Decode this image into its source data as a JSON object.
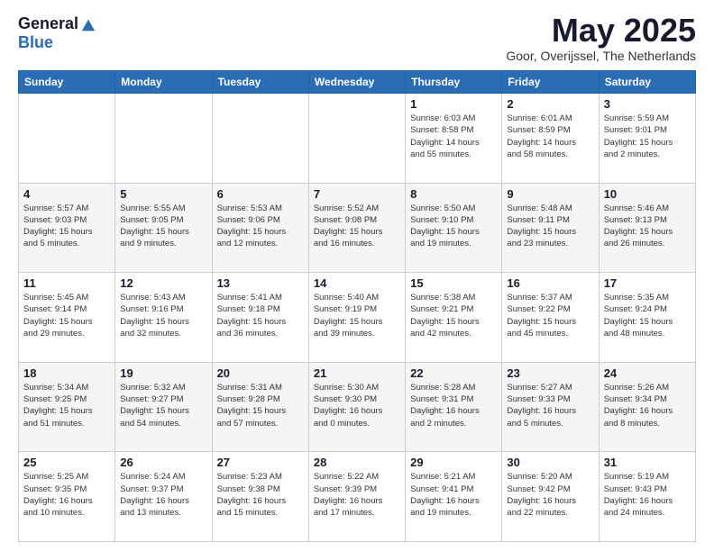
{
  "logo": {
    "general": "General",
    "blue": "Blue"
  },
  "title": "May 2025",
  "location": "Goor, Overijssel, The Netherlands",
  "headers": [
    "Sunday",
    "Monday",
    "Tuesday",
    "Wednesday",
    "Thursday",
    "Friday",
    "Saturday"
  ],
  "weeks": [
    [
      {
        "day": "",
        "info": ""
      },
      {
        "day": "",
        "info": ""
      },
      {
        "day": "",
        "info": ""
      },
      {
        "day": "",
        "info": ""
      },
      {
        "day": "1",
        "info": "Sunrise: 6:03 AM\nSunset: 8:58 PM\nDaylight: 14 hours\nand 55 minutes."
      },
      {
        "day": "2",
        "info": "Sunrise: 6:01 AM\nSunset: 8:59 PM\nDaylight: 14 hours\nand 58 minutes."
      },
      {
        "day": "3",
        "info": "Sunrise: 5:59 AM\nSunset: 9:01 PM\nDaylight: 15 hours\nand 2 minutes."
      }
    ],
    [
      {
        "day": "4",
        "info": "Sunrise: 5:57 AM\nSunset: 9:03 PM\nDaylight: 15 hours\nand 5 minutes."
      },
      {
        "day": "5",
        "info": "Sunrise: 5:55 AM\nSunset: 9:05 PM\nDaylight: 15 hours\nand 9 minutes."
      },
      {
        "day": "6",
        "info": "Sunrise: 5:53 AM\nSunset: 9:06 PM\nDaylight: 15 hours\nand 12 minutes."
      },
      {
        "day": "7",
        "info": "Sunrise: 5:52 AM\nSunset: 9:08 PM\nDaylight: 15 hours\nand 16 minutes."
      },
      {
        "day": "8",
        "info": "Sunrise: 5:50 AM\nSunset: 9:10 PM\nDaylight: 15 hours\nand 19 minutes."
      },
      {
        "day": "9",
        "info": "Sunrise: 5:48 AM\nSunset: 9:11 PM\nDaylight: 15 hours\nand 23 minutes."
      },
      {
        "day": "10",
        "info": "Sunrise: 5:46 AM\nSunset: 9:13 PM\nDaylight: 15 hours\nand 26 minutes."
      }
    ],
    [
      {
        "day": "11",
        "info": "Sunrise: 5:45 AM\nSunset: 9:14 PM\nDaylight: 15 hours\nand 29 minutes."
      },
      {
        "day": "12",
        "info": "Sunrise: 5:43 AM\nSunset: 9:16 PM\nDaylight: 15 hours\nand 32 minutes."
      },
      {
        "day": "13",
        "info": "Sunrise: 5:41 AM\nSunset: 9:18 PM\nDaylight: 15 hours\nand 36 minutes."
      },
      {
        "day": "14",
        "info": "Sunrise: 5:40 AM\nSunset: 9:19 PM\nDaylight: 15 hours\nand 39 minutes."
      },
      {
        "day": "15",
        "info": "Sunrise: 5:38 AM\nSunset: 9:21 PM\nDaylight: 15 hours\nand 42 minutes."
      },
      {
        "day": "16",
        "info": "Sunrise: 5:37 AM\nSunset: 9:22 PM\nDaylight: 15 hours\nand 45 minutes."
      },
      {
        "day": "17",
        "info": "Sunrise: 5:35 AM\nSunset: 9:24 PM\nDaylight: 15 hours\nand 48 minutes."
      }
    ],
    [
      {
        "day": "18",
        "info": "Sunrise: 5:34 AM\nSunset: 9:25 PM\nDaylight: 15 hours\nand 51 minutes."
      },
      {
        "day": "19",
        "info": "Sunrise: 5:32 AM\nSunset: 9:27 PM\nDaylight: 15 hours\nand 54 minutes."
      },
      {
        "day": "20",
        "info": "Sunrise: 5:31 AM\nSunset: 9:28 PM\nDaylight: 15 hours\nand 57 minutes."
      },
      {
        "day": "21",
        "info": "Sunrise: 5:30 AM\nSunset: 9:30 PM\nDaylight: 16 hours\nand 0 minutes."
      },
      {
        "day": "22",
        "info": "Sunrise: 5:28 AM\nSunset: 9:31 PM\nDaylight: 16 hours\nand 2 minutes."
      },
      {
        "day": "23",
        "info": "Sunrise: 5:27 AM\nSunset: 9:33 PM\nDaylight: 16 hours\nand 5 minutes."
      },
      {
        "day": "24",
        "info": "Sunrise: 5:26 AM\nSunset: 9:34 PM\nDaylight: 16 hours\nand 8 minutes."
      }
    ],
    [
      {
        "day": "25",
        "info": "Sunrise: 5:25 AM\nSunset: 9:35 PM\nDaylight: 16 hours\nand 10 minutes."
      },
      {
        "day": "26",
        "info": "Sunrise: 5:24 AM\nSunset: 9:37 PM\nDaylight: 16 hours\nand 13 minutes."
      },
      {
        "day": "27",
        "info": "Sunrise: 5:23 AM\nSunset: 9:38 PM\nDaylight: 16 hours\nand 15 minutes."
      },
      {
        "day": "28",
        "info": "Sunrise: 5:22 AM\nSunset: 9:39 PM\nDaylight: 16 hours\nand 17 minutes."
      },
      {
        "day": "29",
        "info": "Sunrise: 5:21 AM\nSunset: 9:41 PM\nDaylight: 16 hours\nand 19 minutes."
      },
      {
        "day": "30",
        "info": "Sunrise: 5:20 AM\nSunset: 9:42 PM\nDaylight: 16 hours\nand 22 minutes."
      },
      {
        "day": "31",
        "info": "Sunrise: 5:19 AM\nSunset: 9:43 PM\nDaylight: 16 hours\nand 24 minutes."
      }
    ]
  ]
}
